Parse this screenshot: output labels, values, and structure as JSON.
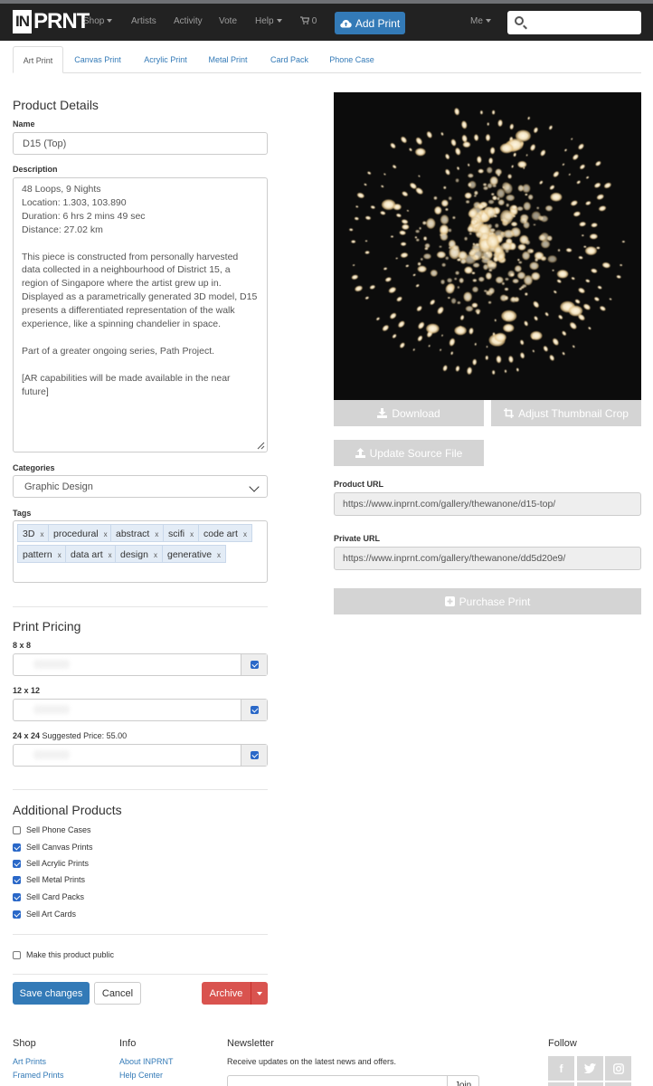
{
  "nav": {
    "logo_in": "IN",
    "logo_prnt": "PRNT",
    "shop": "Shop",
    "artists": "Artists",
    "activity": "Activity",
    "vote": "Vote",
    "help": "Help",
    "cart_count": "0",
    "add_print": "Add Print",
    "me": "Me",
    "search_placeholder": ""
  },
  "tabs": [
    "Art Print",
    "Canvas Print",
    "Acrylic Print",
    "Metal Print",
    "Card Pack",
    "Phone Case"
  ],
  "product": {
    "heading": "Product Details",
    "name_label": "Name",
    "name_value": "D15 (Top)",
    "description_label": "Description",
    "description": "48 Loops, 9 Nights\nLocation: 1.303, 103.890\nDuration: 6 hrs 2 mins 49 sec\nDistance: 27.02 km\n\nThis piece is constructed from personally harvested data collected in a neighbourhood of District 15, a region of Singapore where the artist grew up in. Displayed as a parametrically generated 3D model, D15 presents a differentiated representation of the walk experience, like a spinning chandelier in space.\n\nPart of a greater ongoing series, Path Project.\n\n[AR capabilities will be made available in the near future]",
    "categories_label": "Categories",
    "category_value": "Graphic Design",
    "tags_label": "Tags",
    "tags": [
      "3D",
      "procedural",
      "abstract",
      "scifi",
      "code art",
      "x",
      "pattern",
      "data art",
      "design",
      "generative"
    ],
    "tag_remove": "x"
  },
  "pricing": {
    "heading": "Print Pricing",
    "sizes": [
      {
        "label": "8 x 8",
        "note": "",
        "checked": true
      },
      {
        "label": "12 x 12",
        "note": "",
        "checked": true
      },
      {
        "label": "24 x 24",
        "note": "Suggested Price: 55.00",
        "checked": true
      }
    ]
  },
  "additional": {
    "heading": "Additional Products",
    "items": [
      {
        "label": "Sell Phone Cases",
        "checked": false
      },
      {
        "label": "Sell Canvas Prints",
        "checked": true
      },
      {
        "label": "Sell Acrylic Prints",
        "checked": true
      },
      {
        "label": "Sell Metal Prints",
        "checked": true
      },
      {
        "label": "Sell Card Packs",
        "checked": true
      },
      {
        "label": "Sell Art Cards",
        "checked": true
      }
    ],
    "public_label": "Make this product public",
    "public_checked": false
  },
  "actions": {
    "save": "Save changes",
    "cancel": "Cancel",
    "archive": "Archive"
  },
  "right": {
    "download": "Download",
    "adjust_crop": "Adjust Thumbnail Crop",
    "update_source": "Update Source File",
    "product_url_label": "Product URL",
    "product_url": "https://www.inprnt.com/gallery/thewanone/d15-top/",
    "private_url_label": "Private URL",
    "private_url": "https://www.inprnt.com/gallery/thewanone/dd5d20e9/",
    "purchase": "Purchase Print"
  },
  "footer": {
    "shop_heading": "Shop",
    "shop_links": [
      "Art Prints",
      "Framed Prints"
    ],
    "info_heading": "Info",
    "info_links": [
      "About INPRNT",
      "Help Center"
    ],
    "newsletter_heading": "Newsletter",
    "newsletter_text": "Receive updates on the latest news and offers.",
    "join": "Join",
    "follow_heading": "Follow",
    "social": [
      "f",
      "t",
      "ig"
    ]
  },
  "colors": {
    "navbar": "#222222",
    "primary": "#337ab7",
    "danger": "#d9534f",
    "disabled_button": "#d4d4d4"
  }
}
